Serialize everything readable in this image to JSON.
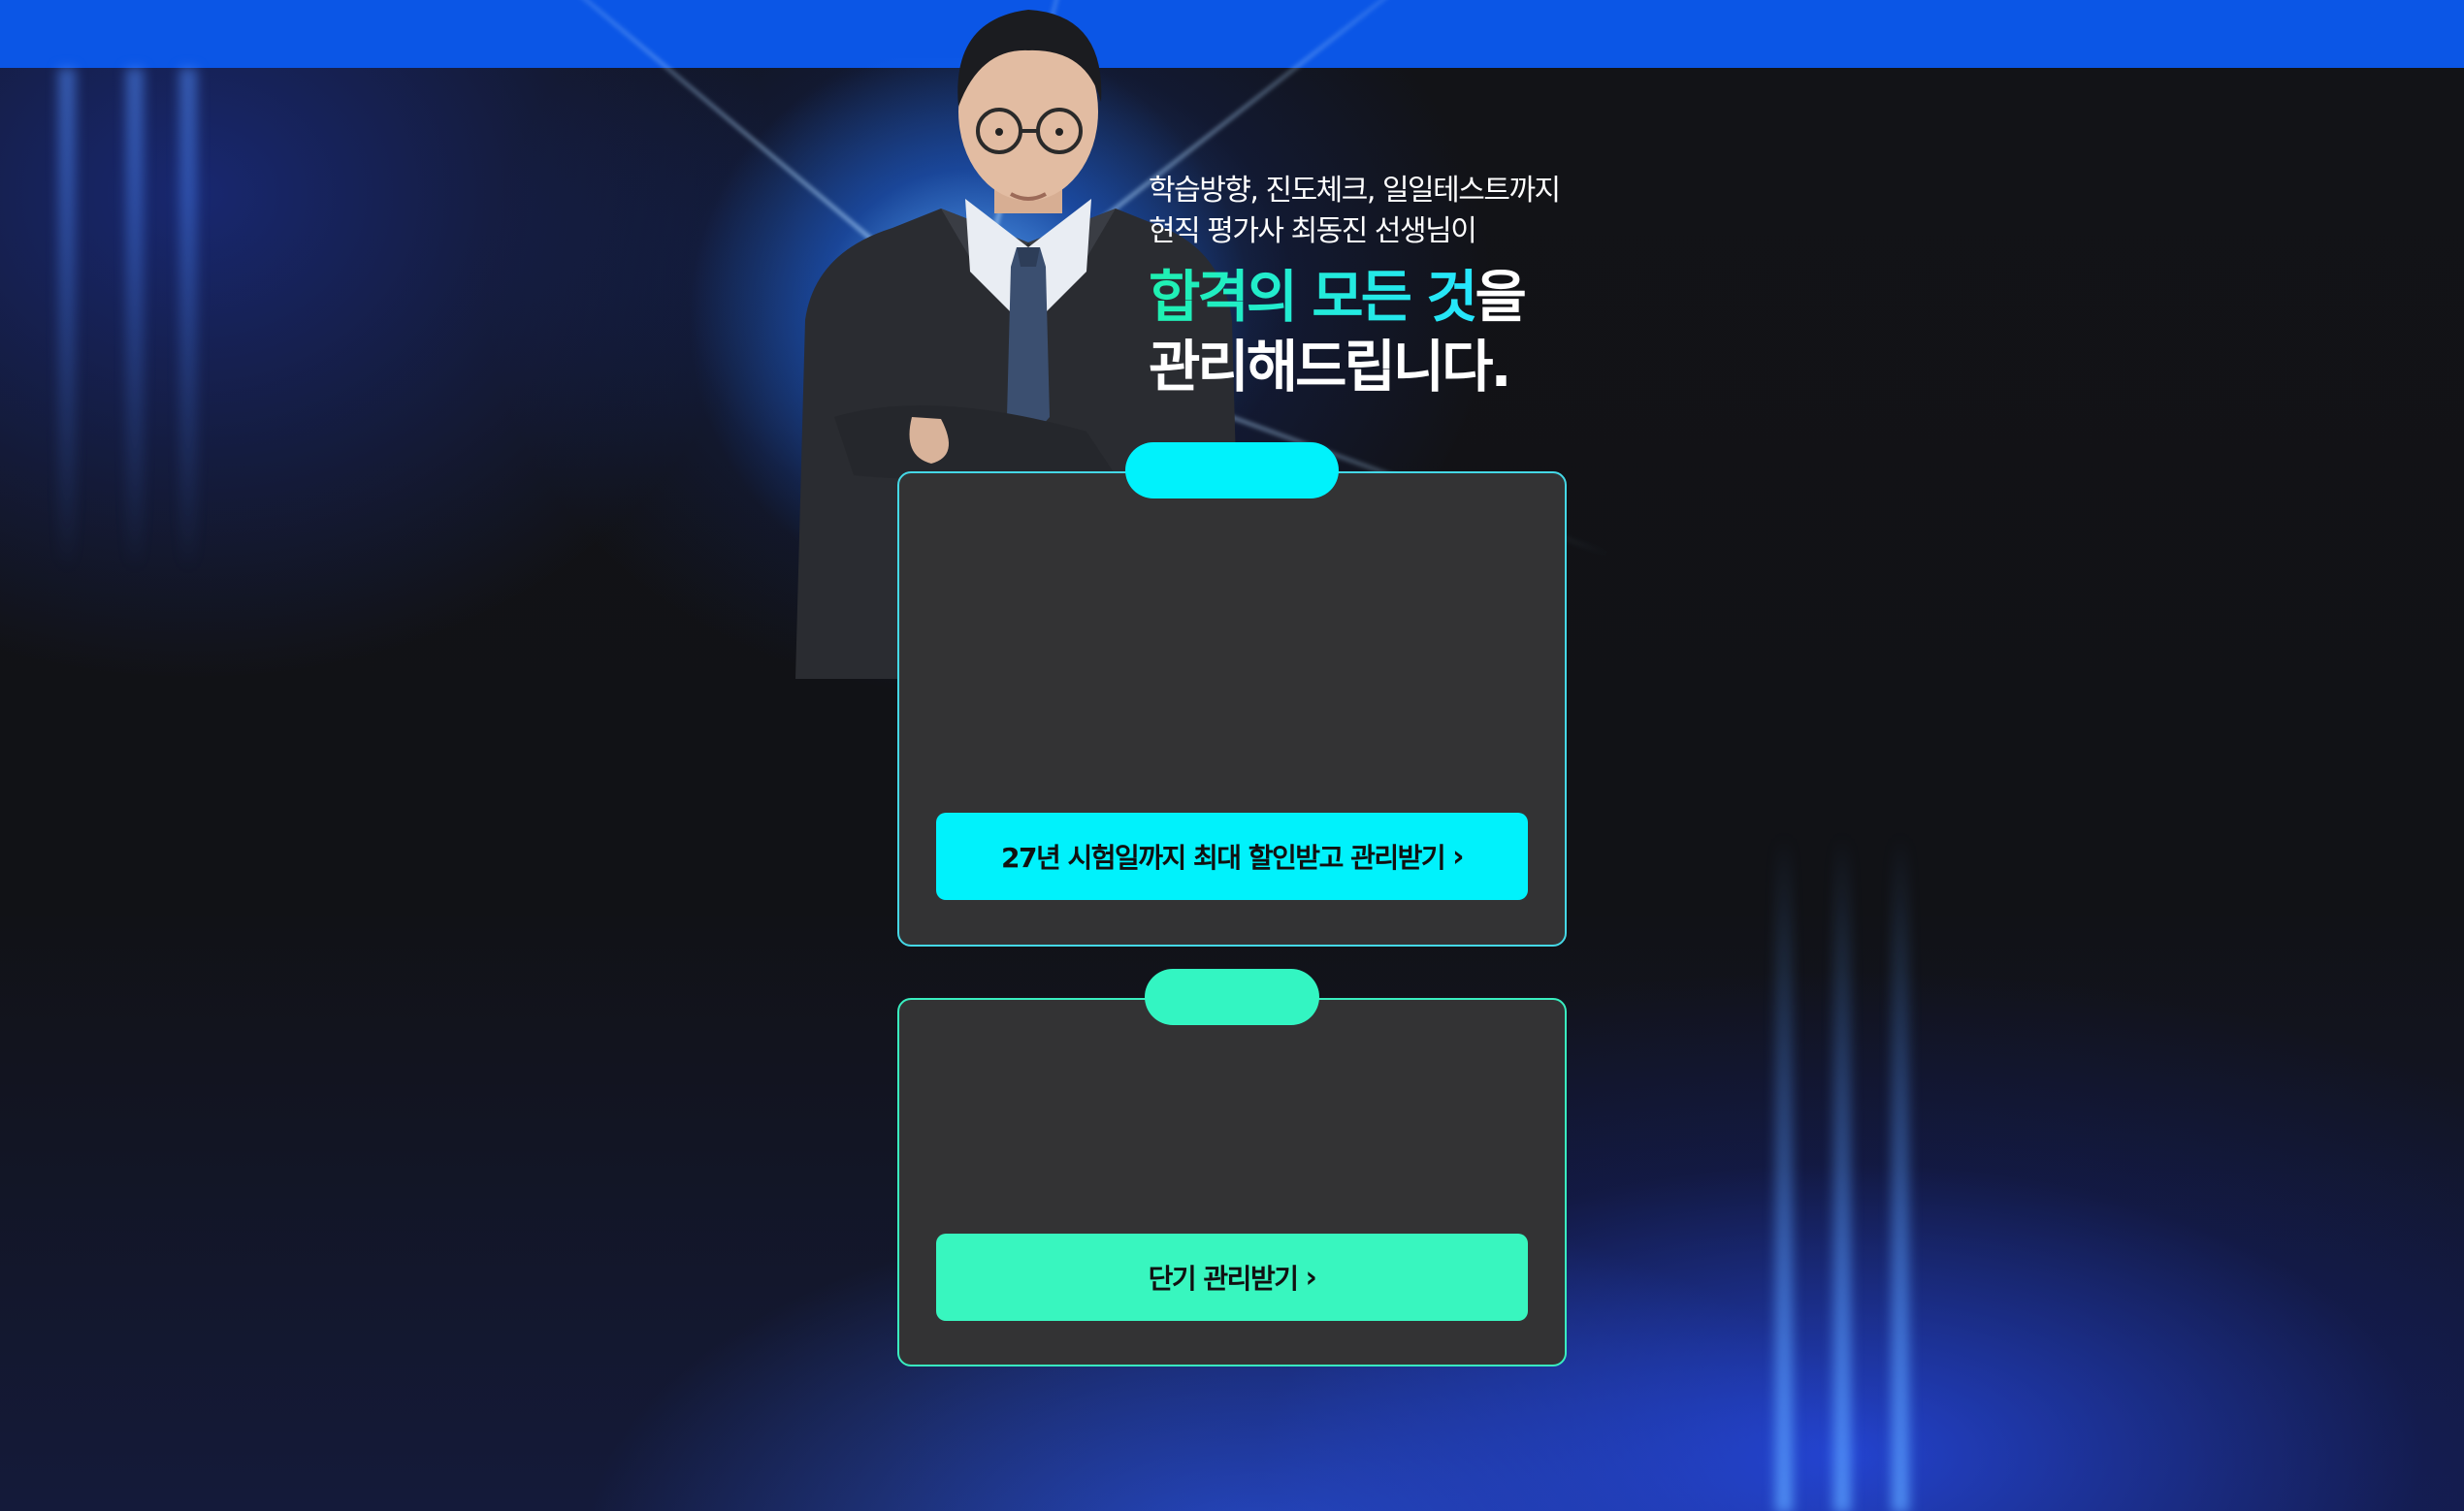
{
  "colors": {
    "top_bar": "#0b56e6",
    "background": "#111216",
    "card_background": "#333334",
    "cyan_accent": "#00f2fc",
    "mint_accent": "#38f6bf",
    "headline_gradient_start": "#1ff0b0",
    "headline_gradient_end": "#26e6ff"
  },
  "hero": {
    "subtitle_line1": "학습방향, 진도체크, 일일테스트까지",
    "subtitle_line2": "현직 평가사 최동진 선생님이",
    "headline_accent": "합격의 모든 것",
    "headline_suffix": "을",
    "headline_line2": "관리해드립니다."
  },
  "card1": {
    "cta_label": "27년 시험일까지 최대 할인받고 관리받기",
    "cta_chevron": "›"
  },
  "card2": {
    "cta_label": "단기 관리받기",
    "cta_chevron": "›"
  }
}
